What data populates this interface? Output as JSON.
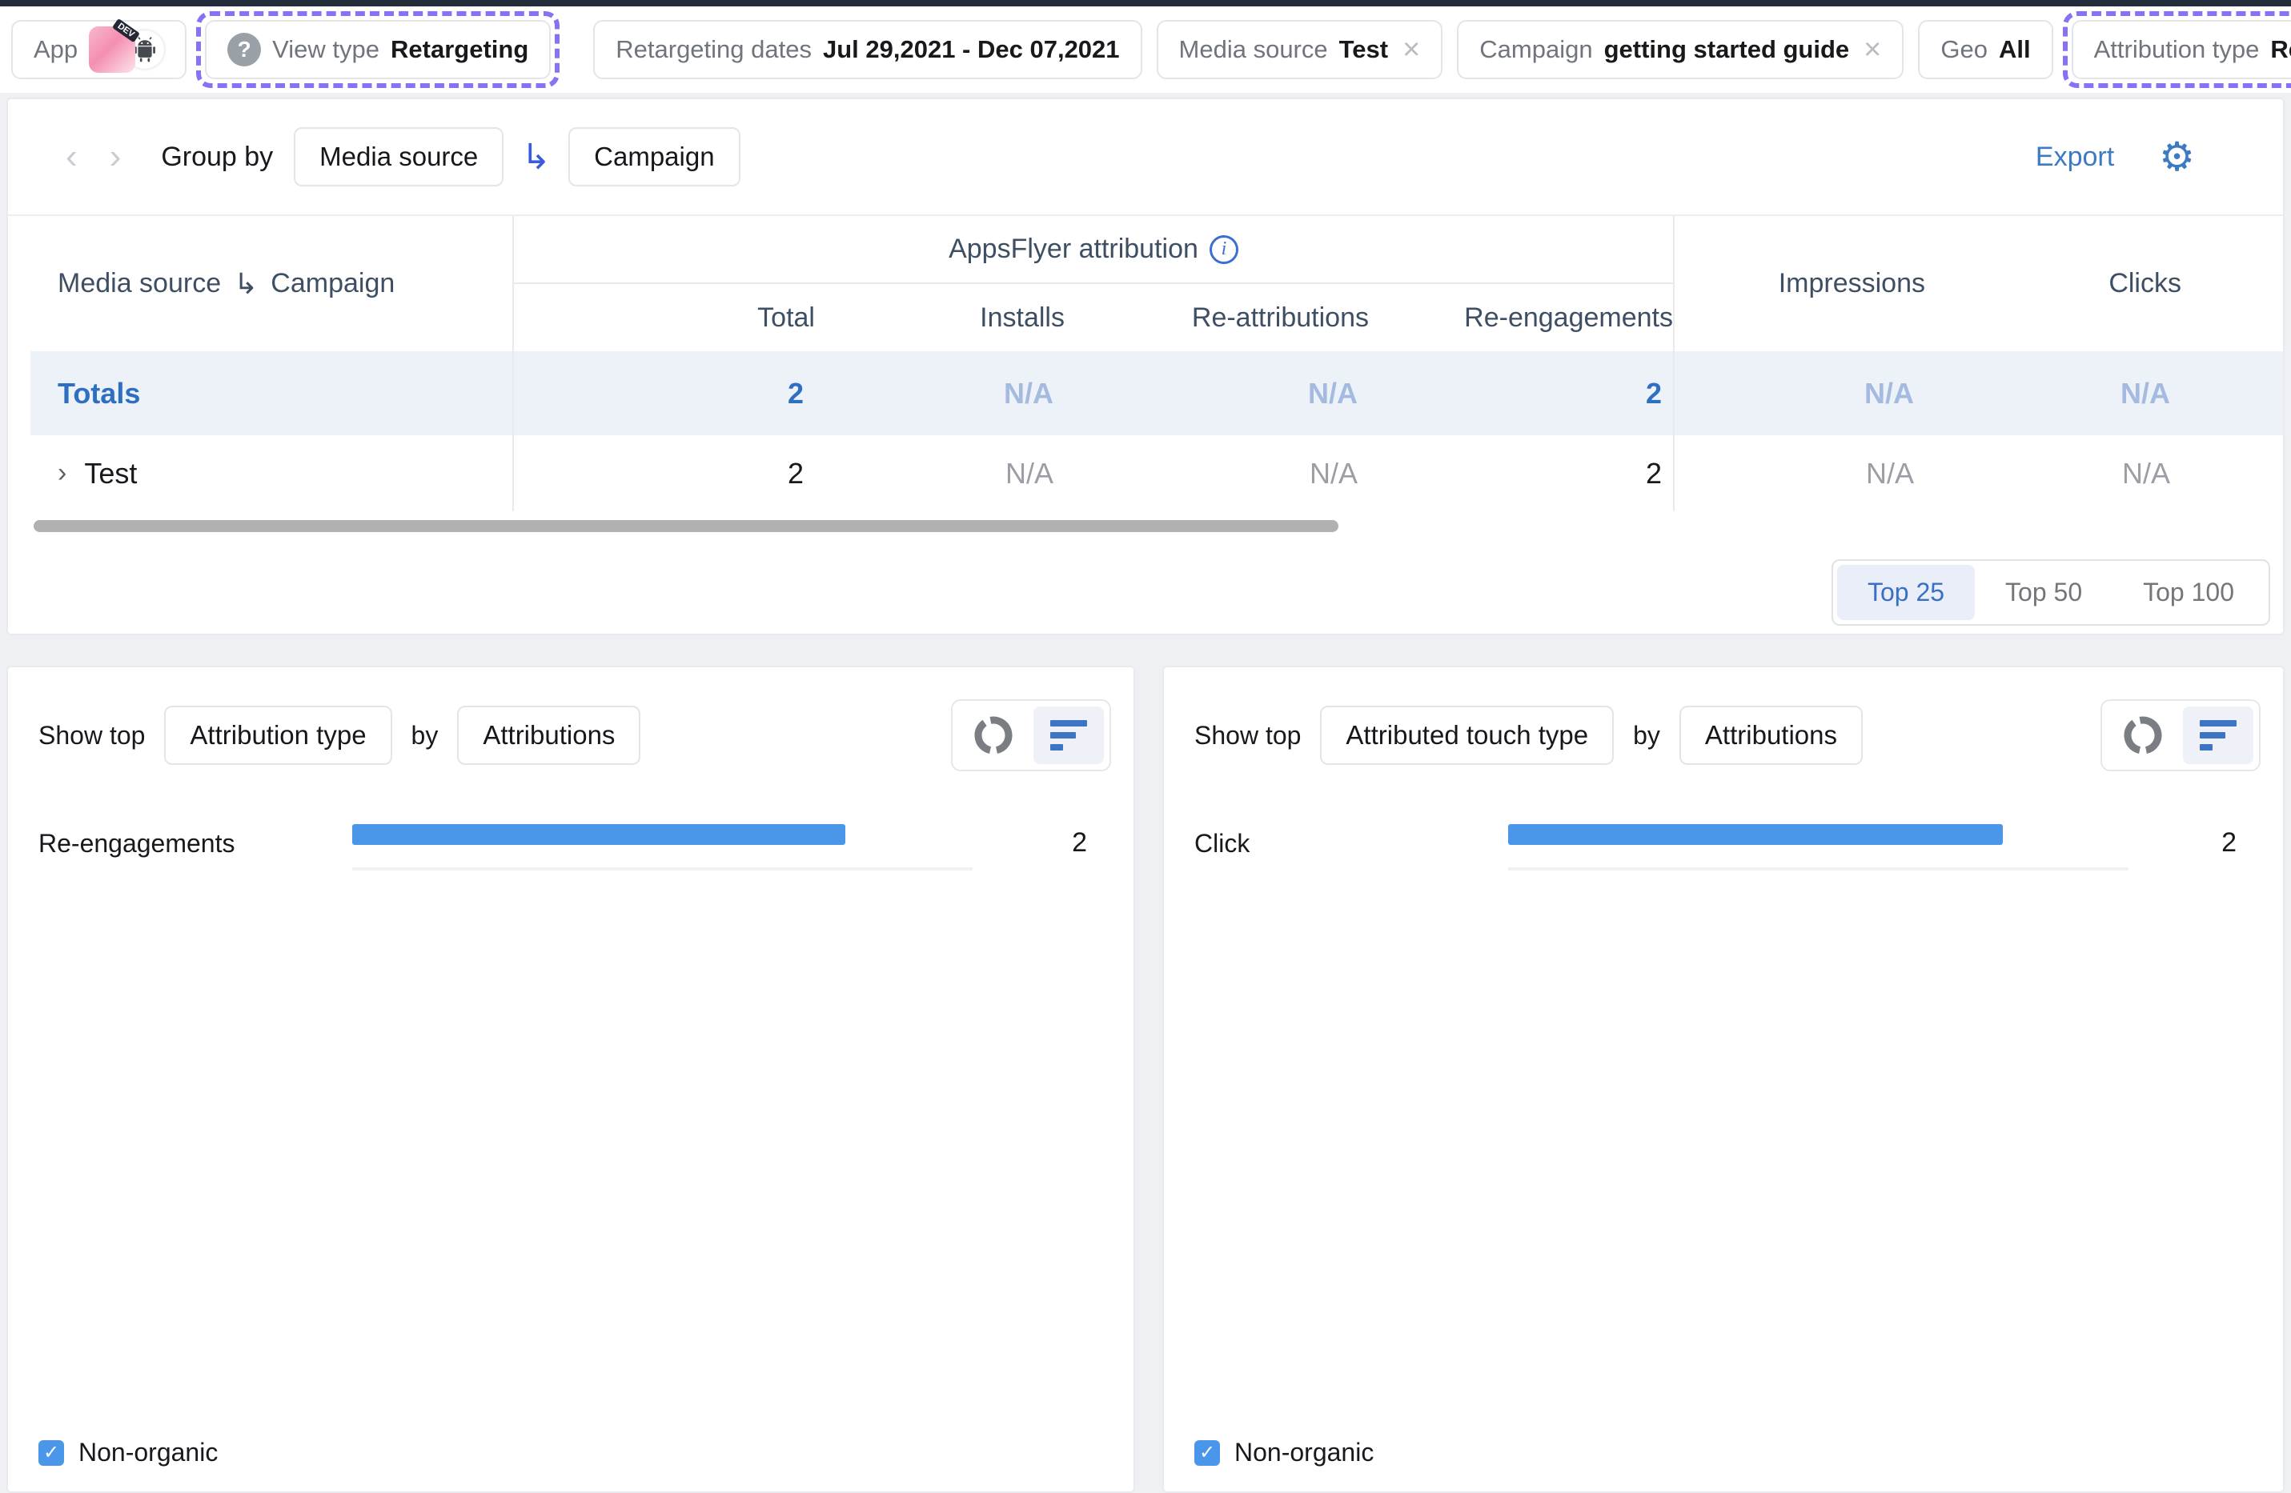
{
  "icons": {
    "gear": "⚙",
    "plus": "+",
    "close": "×",
    "chevron_left": "‹",
    "chevron_right": "›",
    "nested_arrow": "↳",
    "expand_chevron": "›",
    "question_mark": "?",
    "info": "i",
    "check": "✓"
  },
  "colors": {
    "accent_blue": "#3d7ac4",
    "bar_blue": "#4a96e9",
    "highlight_purple": "#8a70f2",
    "totals_row_bg": "#edf2f9",
    "na_blue": "#a5badf",
    "na_gray": "#9b9ea4"
  },
  "filter_bar": {
    "app_chip": {
      "label": "App",
      "badge": "DEV"
    },
    "view_type_chip": {
      "label": "View type",
      "value": "Retargeting"
    },
    "date_chip": {
      "label": "Retargeting dates",
      "value": "Jul 29,2021 - Dec 07,2021"
    },
    "media_source_chip": {
      "label": "Media source",
      "value": "Test"
    },
    "campaign_chip": {
      "label": "Campaign",
      "value": "getting started guide"
    },
    "geo_chip": {
      "label": "Geo",
      "value": "All"
    },
    "attribution_chip": {
      "label": "Attribution type",
      "value": "Re-engagements"
    }
  },
  "toolbar": {
    "group_by_label": "Group by",
    "group_primary": "Media source",
    "group_secondary": "Campaign",
    "export_label": "Export"
  },
  "table": {
    "first_column": {
      "primary": "Media source",
      "secondary": "Campaign"
    },
    "attribution_group_header": "AppsFlyer attribution",
    "columns": {
      "total": "Total",
      "installs": "Installs",
      "re_attributions": "Re-attributions",
      "re_engagements": "Re-engagements",
      "impressions": "Impressions",
      "clicks": "Clicks"
    },
    "totals_row": {
      "name": "Totals",
      "total": "2",
      "installs": "N/A",
      "re_attributions": "N/A",
      "re_engagements": "2",
      "impressions": "N/A",
      "clicks": "N/A"
    },
    "rows": [
      {
        "name": "Test",
        "total": "2",
        "installs": "N/A",
        "re_attributions": "N/A",
        "re_engagements": "2",
        "impressions": "N/A",
        "clicks": "N/A"
      }
    ],
    "top_n": {
      "options": [
        "Top 25",
        "Top 50",
        "Top 100"
      ],
      "selected": "Top 25"
    }
  },
  "charts": [
    {
      "show_top_label": "Show top",
      "dimension": "Attribution type",
      "by_label": "by",
      "metric": "Attributions",
      "bars": [
        {
          "label": "Re-engagements",
          "value": "2",
          "pct": 79.5
        }
      ],
      "checkbox_label": "Non-organic",
      "checkbox_checked": true
    },
    {
      "show_top_label": "Show top",
      "dimension": "Attributed touch type",
      "by_label": "by",
      "metric": "Attributions",
      "bars": [
        {
          "label": "Click",
          "value": "2",
          "pct": 79.8
        }
      ],
      "checkbox_label": "Non-organic",
      "checkbox_checked": true
    }
  ]
}
